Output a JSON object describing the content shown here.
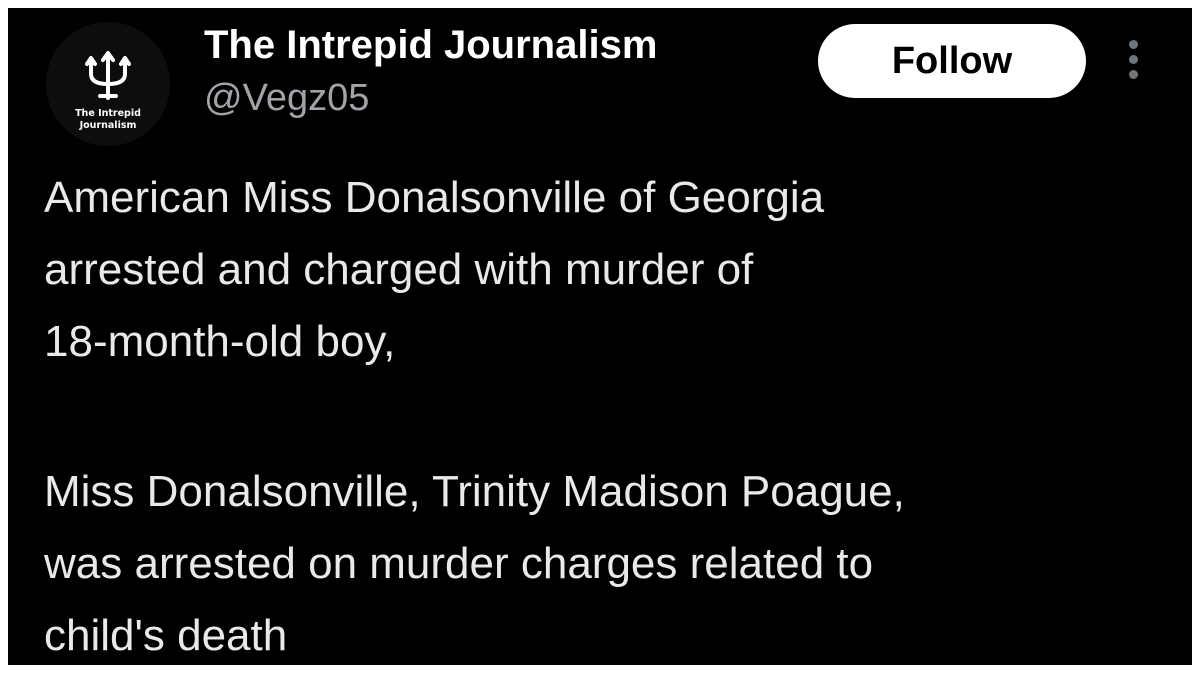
{
  "author": {
    "name": "The Intrepid Journalism",
    "handle": "@Vegz05",
    "avatar": {
      "icon": "trident-icon",
      "line1": "The Intrepid",
      "line2": "Journalism"
    }
  },
  "actions": {
    "follow_label": "Follow",
    "more_icon": "more-vertical-icon"
  },
  "tweet": {
    "paragraph1": [
      "American Miss Donalsonville of Georgia",
      "arrested and charged with murder of",
      "18-month-old boy,"
    ],
    "paragraph2": [
      "Miss Donalsonville, Trinity Madison Poague,",
      "was arrested on murder charges related to",
      "child's death"
    ]
  },
  "colors": {
    "background": "#000000",
    "text": "#e7e9ea",
    "handle": "#a0a4a8",
    "button_bg": "#ffffff",
    "button_text": "#000000",
    "outer_border": "#ffffff"
  }
}
